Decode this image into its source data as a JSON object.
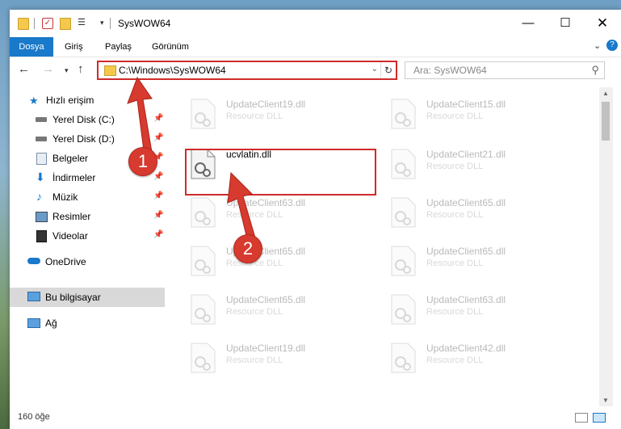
{
  "window": {
    "title": "SysWOW64",
    "controls": {
      "minimize": "—",
      "maximize": "☐",
      "close": "✕"
    }
  },
  "ribbon": {
    "tabs": [
      "Dosya",
      "Giriş",
      "Paylaş",
      "Görünüm"
    ]
  },
  "address": {
    "path": "C:\\Windows\\SysWOW64",
    "search_placeholder": "Ara: SysWOW64"
  },
  "sidebar": {
    "quick_access": "Hızlı erişim",
    "items": [
      {
        "label": "Yerel Disk (C:)",
        "icon": "drive-icon"
      },
      {
        "label": "Yerel Disk (D:)",
        "icon": "drive-icon"
      },
      {
        "label": "Belgeler",
        "icon": "documents-icon"
      },
      {
        "label": "İndirmeler",
        "icon": "downloads-icon"
      },
      {
        "label": "Müzik",
        "icon": "music-icon"
      },
      {
        "label": "Resimler",
        "icon": "pictures-icon"
      },
      {
        "label": "Videolar",
        "icon": "videos-icon"
      }
    ],
    "onedrive": "OneDrive",
    "this_pc": "Bu bilgisayar",
    "network": "Ağ"
  },
  "files": {
    "left": [
      {
        "name": "UpdateClient19.dll",
        "type": "Resource DLL",
        "faded": true
      },
      {
        "name": "ucvlatin.dll",
        "type": "",
        "faded": false
      },
      {
        "name": "UpdateClient63.dll",
        "type": "Resource DLL",
        "faded": true
      },
      {
        "name": "UpdateClient65.dll",
        "type": "Resource DLL",
        "faded": true
      },
      {
        "name": "UpdateClient65.dll",
        "type": "Resource DLL",
        "faded": true
      },
      {
        "name": "UpdateClient19.dll",
        "type": "Resource DLL",
        "faded": true
      }
    ],
    "right": [
      {
        "name": "UpdateClient15.dll",
        "type": "Resource DLL",
        "faded": true
      },
      {
        "name": "UpdateClient21.dll",
        "type": "Resource DLL",
        "faded": true
      },
      {
        "name": "UpdateClient65.dll",
        "type": "Resource DLL",
        "faded": true
      },
      {
        "name": "UpdateClient65.dll",
        "type": "Resource DLL",
        "faded": true
      },
      {
        "name": "UpdateClient63.dll",
        "type": "Resource DLL",
        "faded": true
      },
      {
        "name": "UpdateClient42.dll",
        "type": "Resource DLL",
        "faded": true
      }
    ]
  },
  "status": {
    "count": "160 öğe"
  },
  "callouts": [
    "1",
    "2"
  ],
  "colors": {
    "accent": "#1979ca",
    "highlight": "#d02b2b",
    "badge": "#d73a2e"
  }
}
